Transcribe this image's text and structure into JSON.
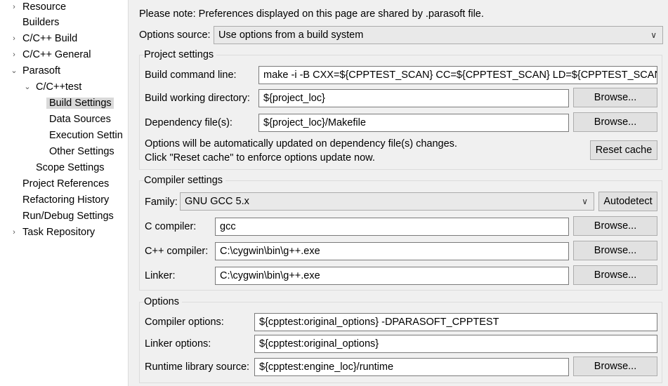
{
  "tree": {
    "items": [
      {
        "label": "Resource",
        "expanded": false
      },
      {
        "label": "Builders"
      },
      {
        "label": "C/C++ Build",
        "expanded": false
      },
      {
        "label": "C/C++ General",
        "expanded": false
      },
      {
        "label": "Parasoft",
        "expanded": true
      },
      {
        "label": "C/C++test",
        "expanded": true
      },
      {
        "label": "Build Settings",
        "selected": true
      },
      {
        "label": "Data Sources"
      },
      {
        "label": "Execution Settin"
      },
      {
        "label": "Other Settings"
      },
      {
        "label": "Scope Settings"
      },
      {
        "label": "Project References"
      },
      {
        "label": "Refactoring History"
      },
      {
        "label": "Run/Debug Settings"
      },
      {
        "label": "Task Repository",
        "expanded": false
      }
    ],
    "icons": {
      "collapsed": "chevron-right-icon",
      "expanded": "chevron-down-icon"
    }
  },
  "note": "Please note: Preferences displayed on this page are shared by .parasoft file.",
  "options_source": {
    "label": "Options source:",
    "value": "Use options from a build system"
  },
  "project_settings": {
    "title": "Project settings",
    "build_command_label": "Build command line:",
    "build_command_value": "make -i -B CXX=${CPPTEST_SCAN} CC=${CPPTEST_SCAN} LD=${CPPTEST_SCAN}",
    "working_dir_label": "Build working directory:",
    "working_dir_value": "${project_loc}",
    "dependency_label": "Dependency file(s):",
    "dependency_value": "${project_loc}/Makefile",
    "info_line1": "Options will be automatically updated on dependency file(s) changes.",
    "info_line2": "Click \"Reset cache\" to enforce options update now.",
    "reset_cache": "Reset cache"
  },
  "compiler_settings": {
    "title": "Compiler settings",
    "family_label": "Family:",
    "family_value": "GNU GCC 5.x",
    "autodetect": "Autodetect",
    "c_compiler_label": "C compiler:",
    "c_compiler_value": "gcc",
    "cpp_compiler_label": "C++ compiler:",
    "cpp_compiler_value": "C:\\cygwin\\bin\\g++.exe",
    "linker_label": "Linker:",
    "linker_value": "C:\\cygwin\\bin\\g++.exe"
  },
  "options": {
    "title": "Options",
    "compiler_options_label": "Compiler options:",
    "compiler_options_value": "${cpptest:original_options} -DPARASOFT_CPPTEST",
    "linker_options_label": "Linker options:",
    "linker_options_value": "${cpptest:original_options}",
    "runtime_label": "Runtime library source:",
    "runtime_value": "${cpptest:engine_loc}/runtime"
  },
  "browse": "Browse..."
}
